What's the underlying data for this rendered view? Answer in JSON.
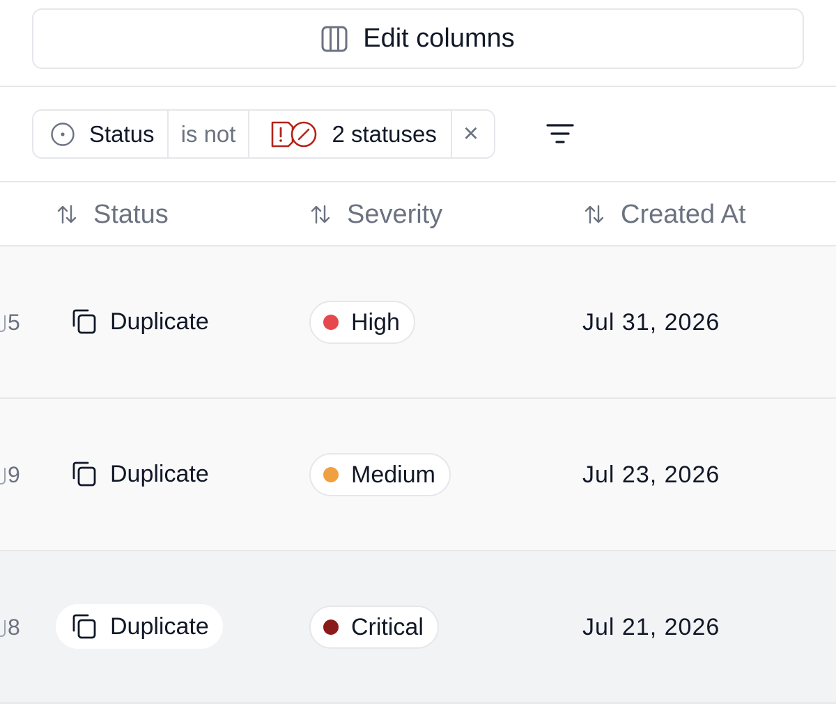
{
  "toolbar": {
    "edit_columns_label": "Edit columns",
    "edit_columns_icon": "columns-icon"
  },
  "filter": {
    "field": "Status",
    "operator": "is not",
    "value_label": "2 statuses",
    "value_icons": [
      "alert-square-icon",
      "ban-icon"
    ],
    "remove_icon": "close-icon",
    "remove_symbol": "×",
    "menu_icon": "filter-lines-icon"
  },
  "table": {
    "columns": [
      {
        "label": "Status",
        "sort_icon": "sort-arrows-icon"
      },
      {
        "label": "Severity",
        "sort_icon": "sort-arrows-icon"
      },
      {
        "label": "Created At",
        "sort_icon": "sort-arrows-icon"
      }
    ],
    "rows": [
      {
        "id_fragment": "5",
        "status": "Duplicate",
        "severity": "High",
        "severity_color": "#e5484d",
        "created_at": "Jul 31, 2026"
      },
      {
        "id_fragment": "9",
        "status": "Duplicate",
        "severity": "Medium",
        "severity_color": "#f0a040",
        "created_at": "Jul 23, 2026"
      },
      {
        "id_fragment": "8",
        "status": "Duplicate",
        "severity": "Critical",
        "severity_color": "#8b1a1a",
        "created_at": "Jul 21, 2026"
      }
    ]
  },
  "colors": {
    "border": "#e5e7eb",
    "muted_text": "#6b7280",
    "alert_red": "#b42318"
  }
}
